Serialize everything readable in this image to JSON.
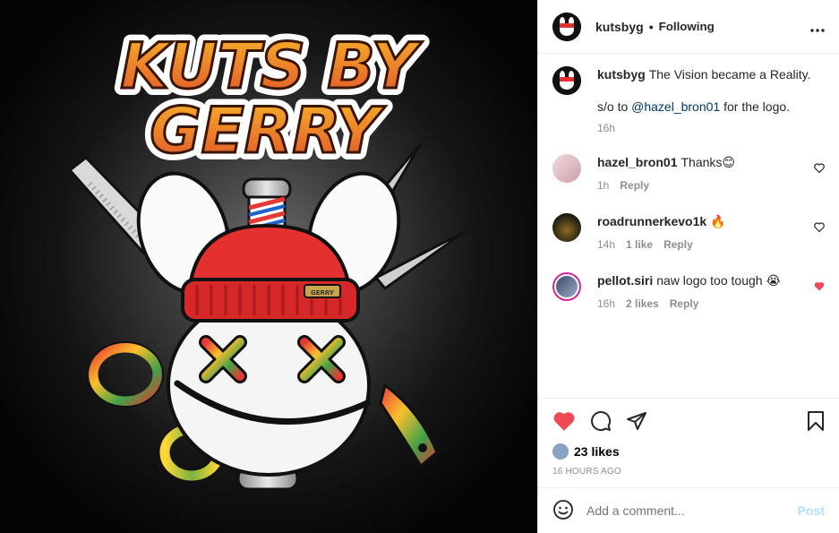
{
  "post": {
    "image_title_line1": "KUTS BY",
    "image_title_line2": "GERRY",
    "hat_tag": "GERRY"
  },
  "header": {
    "username": "kutsbyg",
    "separator": "•",
    "follow_status": "Following",
    "more_icon": "more-horizontal-icon"
  },
  "caption": {
    "username": "kutsbyg",
    "line1": "The Vision became a Reality.",
    "line2_prefix": "s/o to ",
    "mention": "@hazel_bron01",
    "line2_suffix": " for the logo.",
    "time": "16h"
  },
  "comments": [
    {
      "username": "hazel_bron01",
      "text": "Thanks",
      "emoji": "😊",
      "time": "1h",
      "likes": "",
      "reply": "Reply",
      "liked": false
    },
    {
      "username": "roadrunnerkevo1k",
      "text": "",
      "emoji": "🔥",
      "time": "14h",
      "likes": "1 like",
      "reply": "Reply",
      "liked": false
    },
    {
      "username": "pellot.siri",
      "text": "naw logo too tough",
      "emoji": "😭",
      "time": "16h",
      "likes": "2 likes",
      "reply": "Reply",
      "liked": true
    }
  ],
  "footer": {
    "likes": "23 likes",
    "time_ago": "16 HOURS AGO",
    "comment_placeholder": "Add a comment...",
    "post_label": "Post"
  },
  "colors": {
    "like_red": "#ed4956",
    "link_blue": "#00376b",
    "post_disabled": "#b2dffc"
  }
}
